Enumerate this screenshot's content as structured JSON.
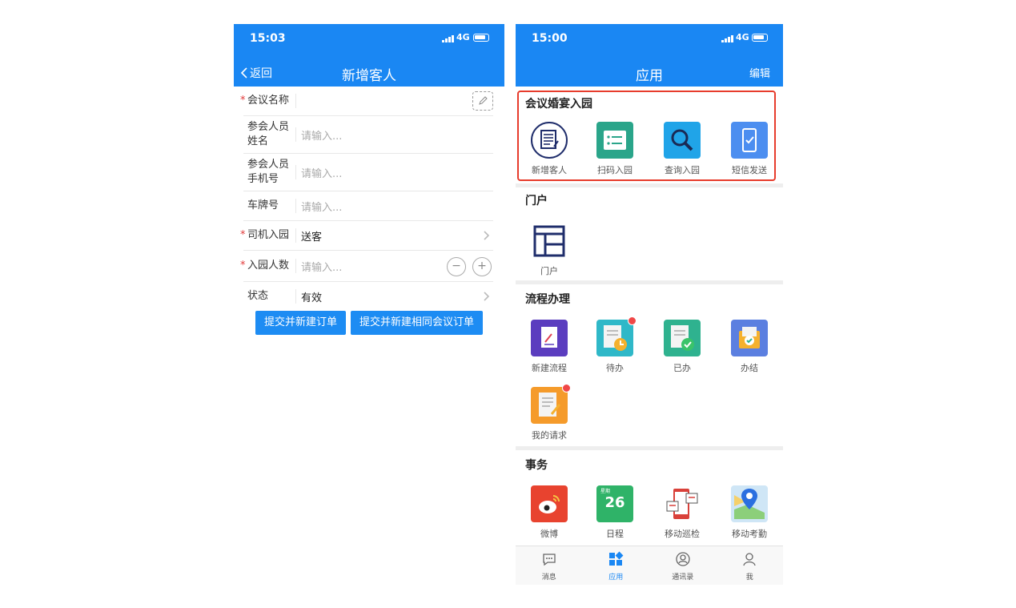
{
  "left_phone": {
    "status": {
      "time": "15:03",
      "network": "4G"
    },
    "nav": {
      "back_label": "返回",
      "title": "新增客人"
    },
    "form": {
      "rows": [
        {
          "label": "会议名称",
          "required": true,
          "value": ""
        },
        {
          "label": "参会人员姓名",
          "required": false,
          "value": "请输入..."
        },
        {
          "label": "参会人员手机号",
          "required": false,
          "value": "请输入..."
        },
        {
          "label": "车牌号",
          "required": false,
          "value": "请输入..."
        },
        {
          "label": "司机入园",
          "required": true,
          "value": "送客"
        },
        {
          "label": "入园人数",
          "required": true,
          "value": "请输入..."
        },
        {
          "label": "状态",
          "required": false,
          "value": "有效"
        }
      ],
      "row1_label_a": "参会人员",
      "row1_label_b": "姓名",
      "row2_label_a": "参会人员",
      "row2_label_b": "手机号",
      "stepper": {
        "minus": "−",
        "plus": "+"
      }
    },
    "buttons": {
      "submit_new": "提交并新建订单",
      "submit_same": "提交并新建相同会议订单"
    }
  },
  "right_phone": {
    "status": {
      "time": "15:00",
      "network": "4G"
    },
    "nav": {
      "title": "应用",
      "edit_label": "编辑"
    },
    "sections": [
      {
        "title": "会议婚宴入园",
        "apps": [
          "新增客人",
          "扫码入园",
          "查询入园",
          "短信发送"
        ]
      },
      {
        "title": "门户",
        "apps": [
          "门户"
        ]
      },
      {
        "title": "流程办理",
        "apps": [
          "新建流程",
          "待办",
          "已办",
          "办结",
          "我的请求"
        ]
      },
      {
        "title": "事务",
        "apps": [
          "微博",
          "日程",
          "移动巡检",
          "移动考勤"
        ]
      }
    ],
    "calendar_day": "26",
    "calendar_small": "星期",
    "tabs": [
      "消息",
      "应用",
      "通讯录",
      "我"
    ],
    "active_tab": "应用"
  },
  "colors": {
    "brand_blue": "#1a87f3",
    "highlight_red": "#e73c2c",
    "badge_red": "#f04747"
  }
}
